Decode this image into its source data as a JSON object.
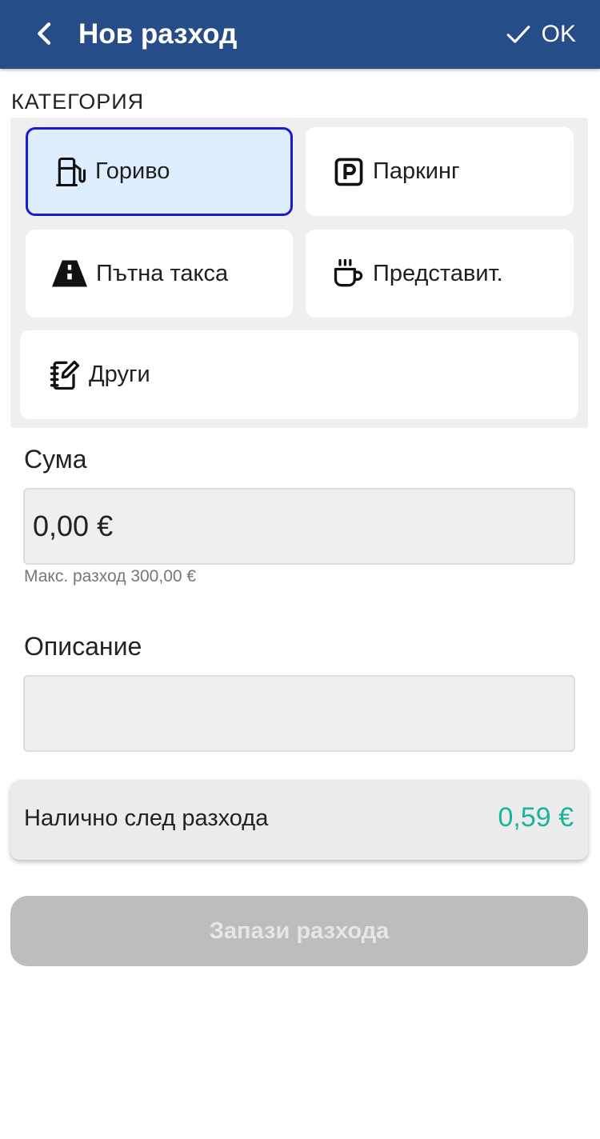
{
  "appbar": {
    "title": "Нов разход",
    "ok_label": "OK",
    "color": "#264d88"
  },
  "category": {
    "section_label": "КАТЕГОРИЯ",
    "items": [
      {
        "label": "Гориво",
        "icon": "fuel-pump-icon",
        "selected": true
      },
      {
        "label": "Паркинг",
        "icon": "parking-icon",
        "selected": false
      },
      {
        "label": "Пътна такса",
        "icon": "road-icon",
        "selected": false
      },
      {
        "label": "Представит.",
        "icon": "coffee-cup-icon",
        "selected": false
      },
      {
        "label": "Други",
        "icon": "notebook-edit-icon",
        "selected": false
      }
    ]
  },
  "amount": {
    "title": "Сума",
    "value": "0,00 €",
    "hint": "Макс. разход 300,00 €"
  },
  "description": {
    "title": "Описание",
    "value": ""
  },
  "balance": {
    "label": "Налично след разхода",
    "value": "0,59 €",
    "value_color": "#19b59a"
  },
  "save_button": {
    "label": "Запази разхода",
    "enabled": false
  }
}
